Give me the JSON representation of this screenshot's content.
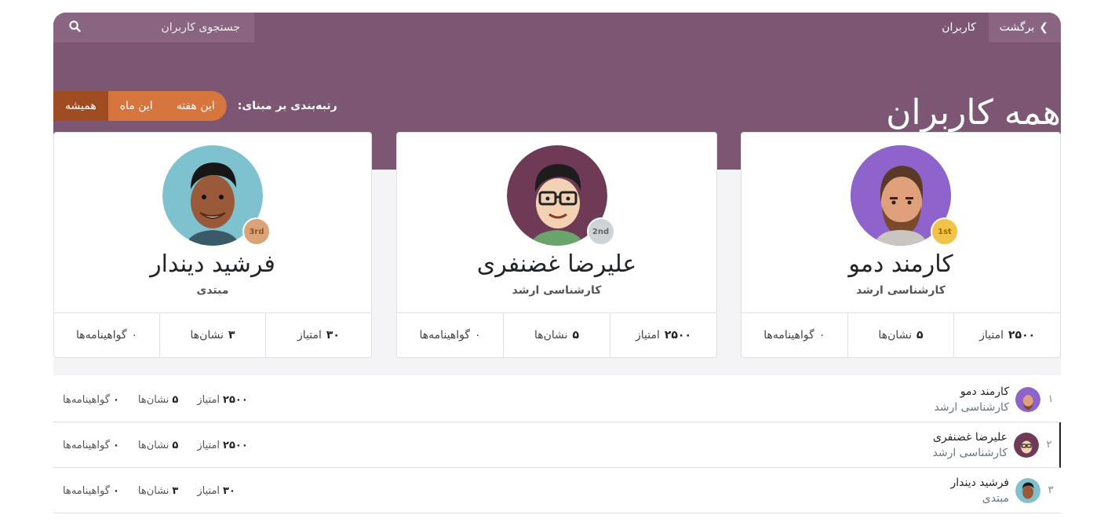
{
  "topbar": {
    "back_label": "برگشت",
    "crumb": "کاربران",
    "search_placeholder": "جستجوی کاربران"
  },
  "banner": {
    "title": "همه کاربران",
    "rank_label": "رتبه‌بندی بر مبنای:",
    "rank_options": [
      "این هفته",
      "این ماه",
      "همیشه"
    ],
    "active_option": "همیشه"
  },
  "podium": [
    {
      "name": "کارمند دمو",
      "rank": "کارشناسی ارشد",
      "medal": "1st",
      "points": "۲۵۰۰",
      "points_label": "امتیاز",
      "badges": "۵",
      "badges_label": "نشان‌ها",
      "certs": "۰",
      "certs_label": "گواهینامه‌ها"
    },
    {
      "name": "علیرضا غضنفری",
      "rank": "کارشناسی ارشد",
      "medal": "2nd",
      "points": "۲۵۰۰",
      "points_label": "امتیاز",
      "badges": "۵",
      "badges_label": "نشان‌ها",
      "certs": "۰",
      "certs_label": "گواهینامه‌ها"
    },
    {
      "name": "فرشید دیندار",
      "rank": "مبتدی",
      "medal": "3rd",
      "points": "۳۰",
      "points_label": "امتیاز",
      "badges": "۳",
      "badges_label": "نشان‌ها",
      "certs": "۰",
      "certs_label": "گواهینامه‌ها"
    }
  ],
  "list": [
    {
      "num": "۱",
      "name": "کارمند دمو",
      "rank": "کارشناسی ارشد",
      "points": "۲۵۰۰",
      "points_label": "امتیاز",
      "badges": "۵",
      "badges_label": "نشان‌ها",
      "certs": "۰",
      "certs_label": "گواهینامه‌ها"
    },
    {
      "num": "۲",
      "name": "علیرضا غضنفری",
      "rank": "کارشناسی ارشد",
      "points": "۲۵۰۰",
      "points_label": "امتیاز",
      "badges": "۵",
      "badges_label": "نشان‌ها",
      "certs": "۰",
      "certs_label": "گواهینامه‌ها"
    },
    {
      "num": "۳",
      "name": "فرشید دیندار",
      "rank": "مبتدی",
      "points": "۳۰",
      "points_label": "امتیاز",
      "badges": "۳",
      "badges_label": "نشان‌ها",
      "certs": "۰",
      "certs_label": "گواهینامه‌ها"
    }
  ],
  "colors": {
    "header": "#7c5673",
    "orange": "#d6753d",
    "active": "#a04c22"
  }
}
